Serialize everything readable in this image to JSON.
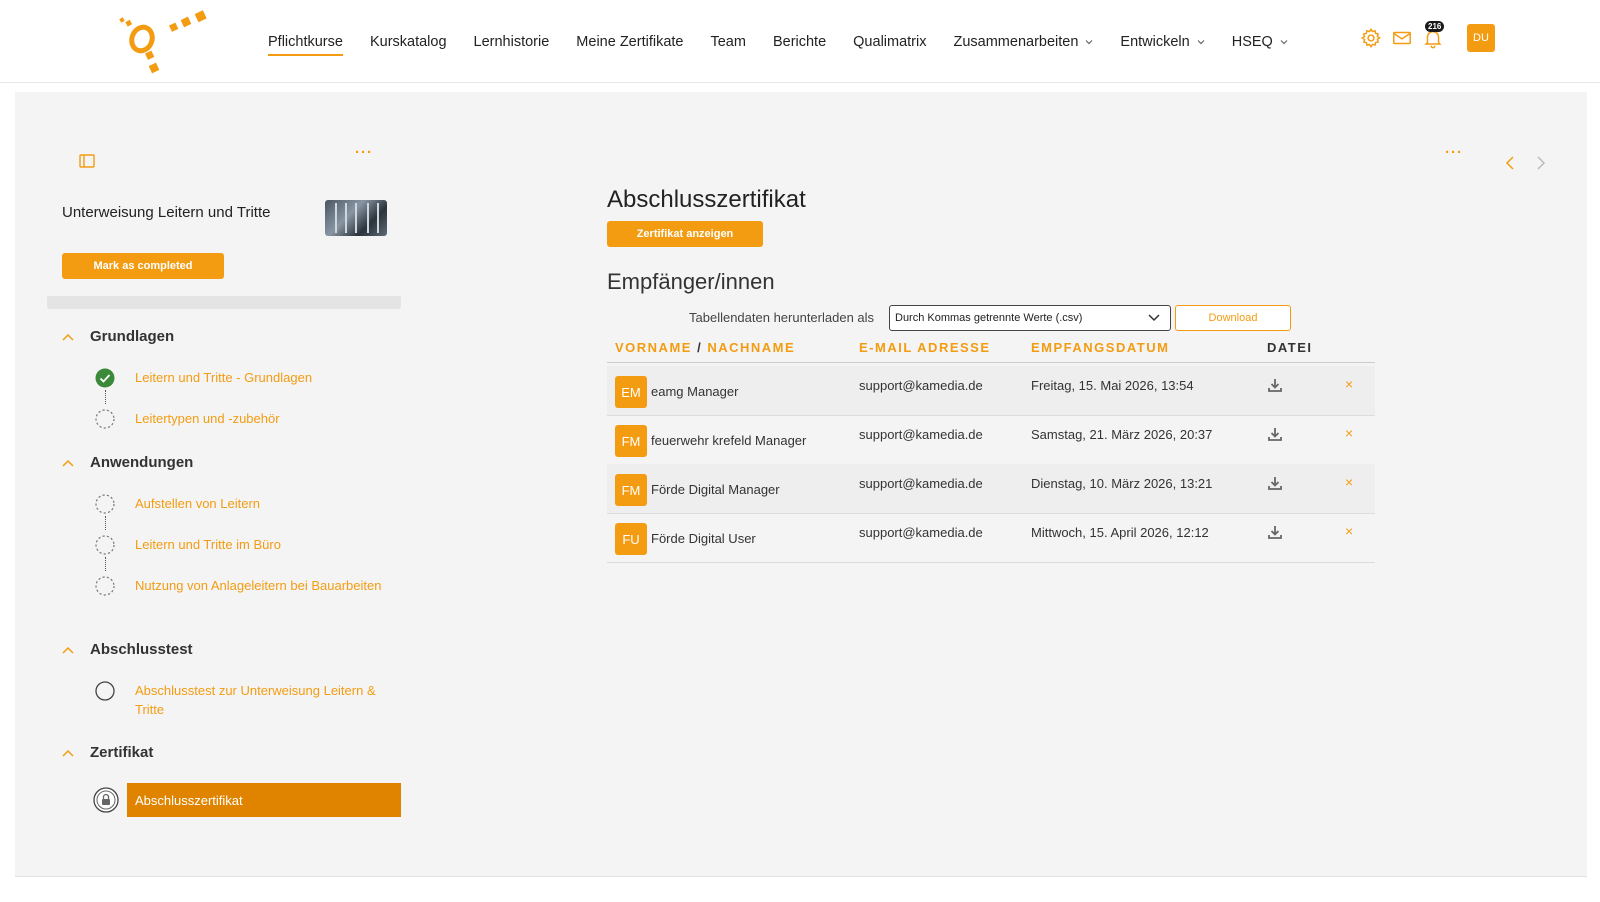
{
  "nav": {
    "items": [
      {
        "label": "Pflichtkurse",
        "active": true,
        "dropdown": false
      },
      {
        "label": "Kurskatalog",
        "active": false,
        "dropdown": false
      },
      {
        "label": "Lernhistorie",
        "active": false,
        "dropdown": false
      },
      {
        "label": "Meine Zertifikate",
        "active": false,
        "dropdown": false
      },
      {
        "label": "Team",
        "active": false,
        "dropdown": false
      },
      {
        "label": "Berichte",
        "active": false,
        "dropdown": false
      },
      {
        "label": "Qualimatrix",
        "active": false,
        "dropdown": false
      },
      {
        "label": "Zusammenarbeiten",
        "active": false,
        "dropdown": true
      },
      {
        "label": "Entwickeln",
        "active": false,
        "dropdown": true
      },
      {
        "label": "HSEQ",
        "active": false,
        "dropdown": true
      }
    ],
    "icons": [
      "gear-icon",
      "mail-icon",
      "bell-icon"
    ],
    "notification_count": "216",
    "user_initials": "DU"
  },
  "colors": {
    "accent": "#f39c12",
    "accent_dark": "#e08400",
    "success": "#3a8a3a"
  },
  "course": {
    "title": "Unterweisung Leitern und Tritte",
    "mark_completed": "Mark as completed"
  },
  "outline": {
    "sections": [
      {
        "title": "Grundlagen",
        "lessons": [
          {
            "label": "Leitern und Tritte - Grundlagen",
            "status": "completed"
          },
          {
            "label": "Leitertypen und -zubehör",
            "status": "open"
          }
        ]
      },
      {
        "title": "Anwendungen",
        "lessons": [
          {
            "label": "Aufstellen von Leitern",
            "status": "open"
          },
          {
            "label": "Leitern und Tritte im Büro",
            "status": "open"
          },
          {
            "label": "Nutzung von Anlageleitern bei Bauarbeiten",
            "status": "open"
          }
        ]
      },
      {
        "title": "Abschlusstest",
        "lessons": [
          {
            "label": "Abschlusstest zur Unterweisung Leitern & Tritte",
            "status": "test"
          }
        ]
      },
      {
        "title": "Zertifikat",
        "lessons": [
          {
            "label": "Abschlusszertifikat",
            "status": "locked",
            "active": true
          }
        ]
      }
    ]
  },
  "content": {
    "title": "Abschlusszertifikat",
    "show_certificate": "Zertifikat anzeigen",
    "recipients_title": "Empfänger/innen",
    "download_label": "Tabellendaten herunterladen als",
    "format_selected": "Durch Kommas getrennte Werte (.csv)",
    "download_button": "Download",
    "columns": {
      "firstname": "VORNAME",
      "separator": "/",
      "lastname": "NACHNAME",
      "email": "E-MAIL ADRESSE",
      "date": "EMPFANGSDATUM",
      "file": "DATEI"
    },
    "rows": [
      {
        "initials": "EM",
        "name": "eamg Manager",
        "email": "support@kamedia.de",
        "date": "Freitag, 15. Mai 2026, 13:54"
      },
      {
        "initials": "FM",
        "name": "feuerwehr krefeld Manager",
        "email": "support@kamedia.de",
        "date": "Samstag, 21. März 2026, 20:37"
      },
      {
        "initials": "FM",
        "name": "Förde Digital Manager",
        "email": "support@kamedia.de",
        "date": "Dienstag, 10. März 2026, 13:21"
      },
      {
        "initials": "FU",
        "name": "Förde Digital User",
        "email": "support@kamedia.de",
        "date": "Mittwoch, 15. April 2026, 12:12"
      }
    ],
    "delete_glyph": "×"
  }
}
